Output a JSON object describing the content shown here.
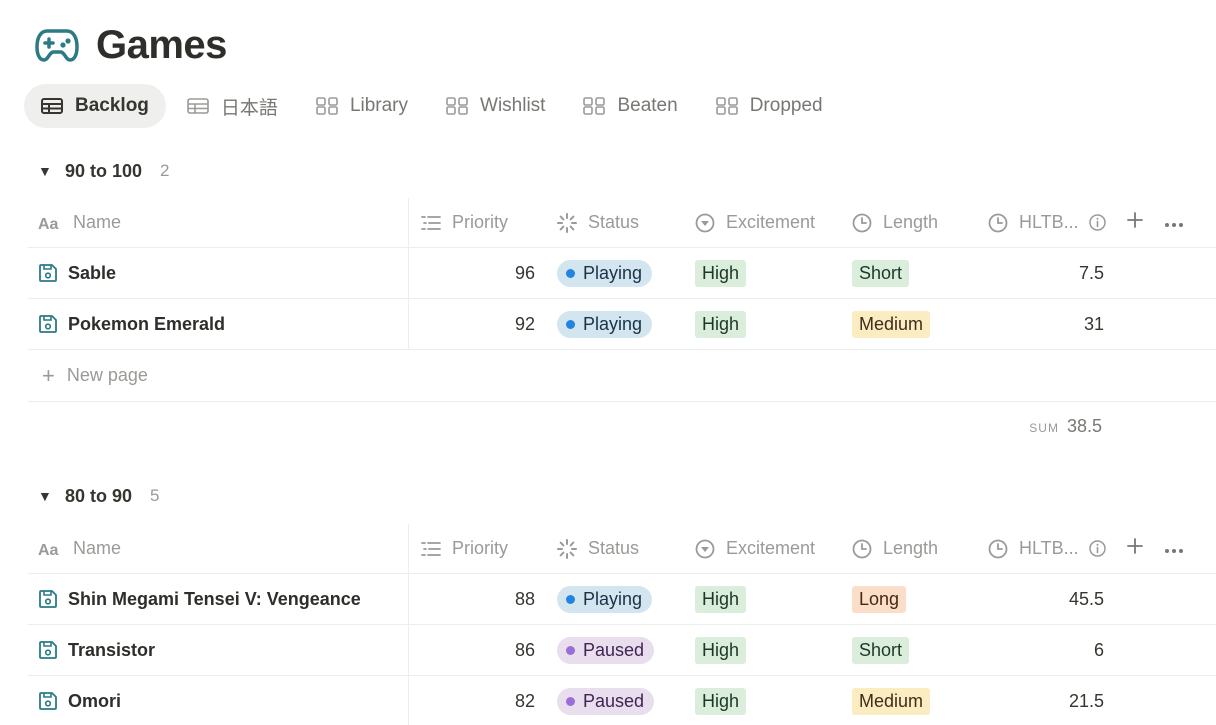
{
  "page": {
    "title": "Games",
    "icon": "gamepad-icon"
  },
  "tabs": [
    {
      "label": "Backlog",
      "icon": "table-icon",
      "active": true
    },
    {
      "label": "日本語",
      "icon": "table-icon",
      "active": false
    },
    {
      "label": "Library",
      "icon": "gallery-icon",
      "active": false
    },
    {
      "label": "Wishlist",
      "icon": "gallery-icon",
      "active": false
    },
    {
      "label": "Beaten",
      "icon": "gallery-icon",
      "active": false
    },
    {
      "label": "Dropped",
      "icon": "gallery-icon",
      "active": false
    }
  ],
  "columns": {
    "name": "Name",
    "priority": "Priority",
    "status": "Status",
    "excitement": "Excitement",
    "length": "Length",
    "hltb": "HLTB..."
  },
  "groups": [
    {
      "title": "90 to 100",
      "count": "2",
      "rows": [
        {
          "name": "Sable",
          "priority": "96",
          "status": "Playing",
          "excitement": "High",
          "length": "Short",
          "hltb": "7.5"
        },
        {
          "name": "Pokemon Emerald",
          "priority": "92",
          "status": "Playing",
          "excitement": "High",
          "length": "Medium",
          "hltb": "31"
        }
      ],
      "new_page_label": "New page",
      "sum_label": "SUM",
      "sum_value": "38.5"
    },
    {
      "title": "80 to 90",
      "count": "5",
      "rows": [
        {
          "name": "Shin Megami Tensei V: Vengeance",
          "priority": "88",
          "status": "Playing",
          "excitement": "High",
          "length": "Long",
          "hltb": "45.5"
        },
        {
          "name": "Transistor",
          "priority": "86",
          "status": "Paused",
          "excitement": "High",
          "length": "Short",
          "hltb": "6"
        },
        {
          "name": "Omori",
          "priority": "82",
          "status": "Paused",
          "excitement": "High",
          "length": "Medium",
          "hltb": "21.5"
        }
      ]
    }
  ],
  "colors": {
    "accent_teal": "#2b7a84",
    "playing_dot": "#2383e2",
    "paused_dot": "#9a6dd7"
  }
}
